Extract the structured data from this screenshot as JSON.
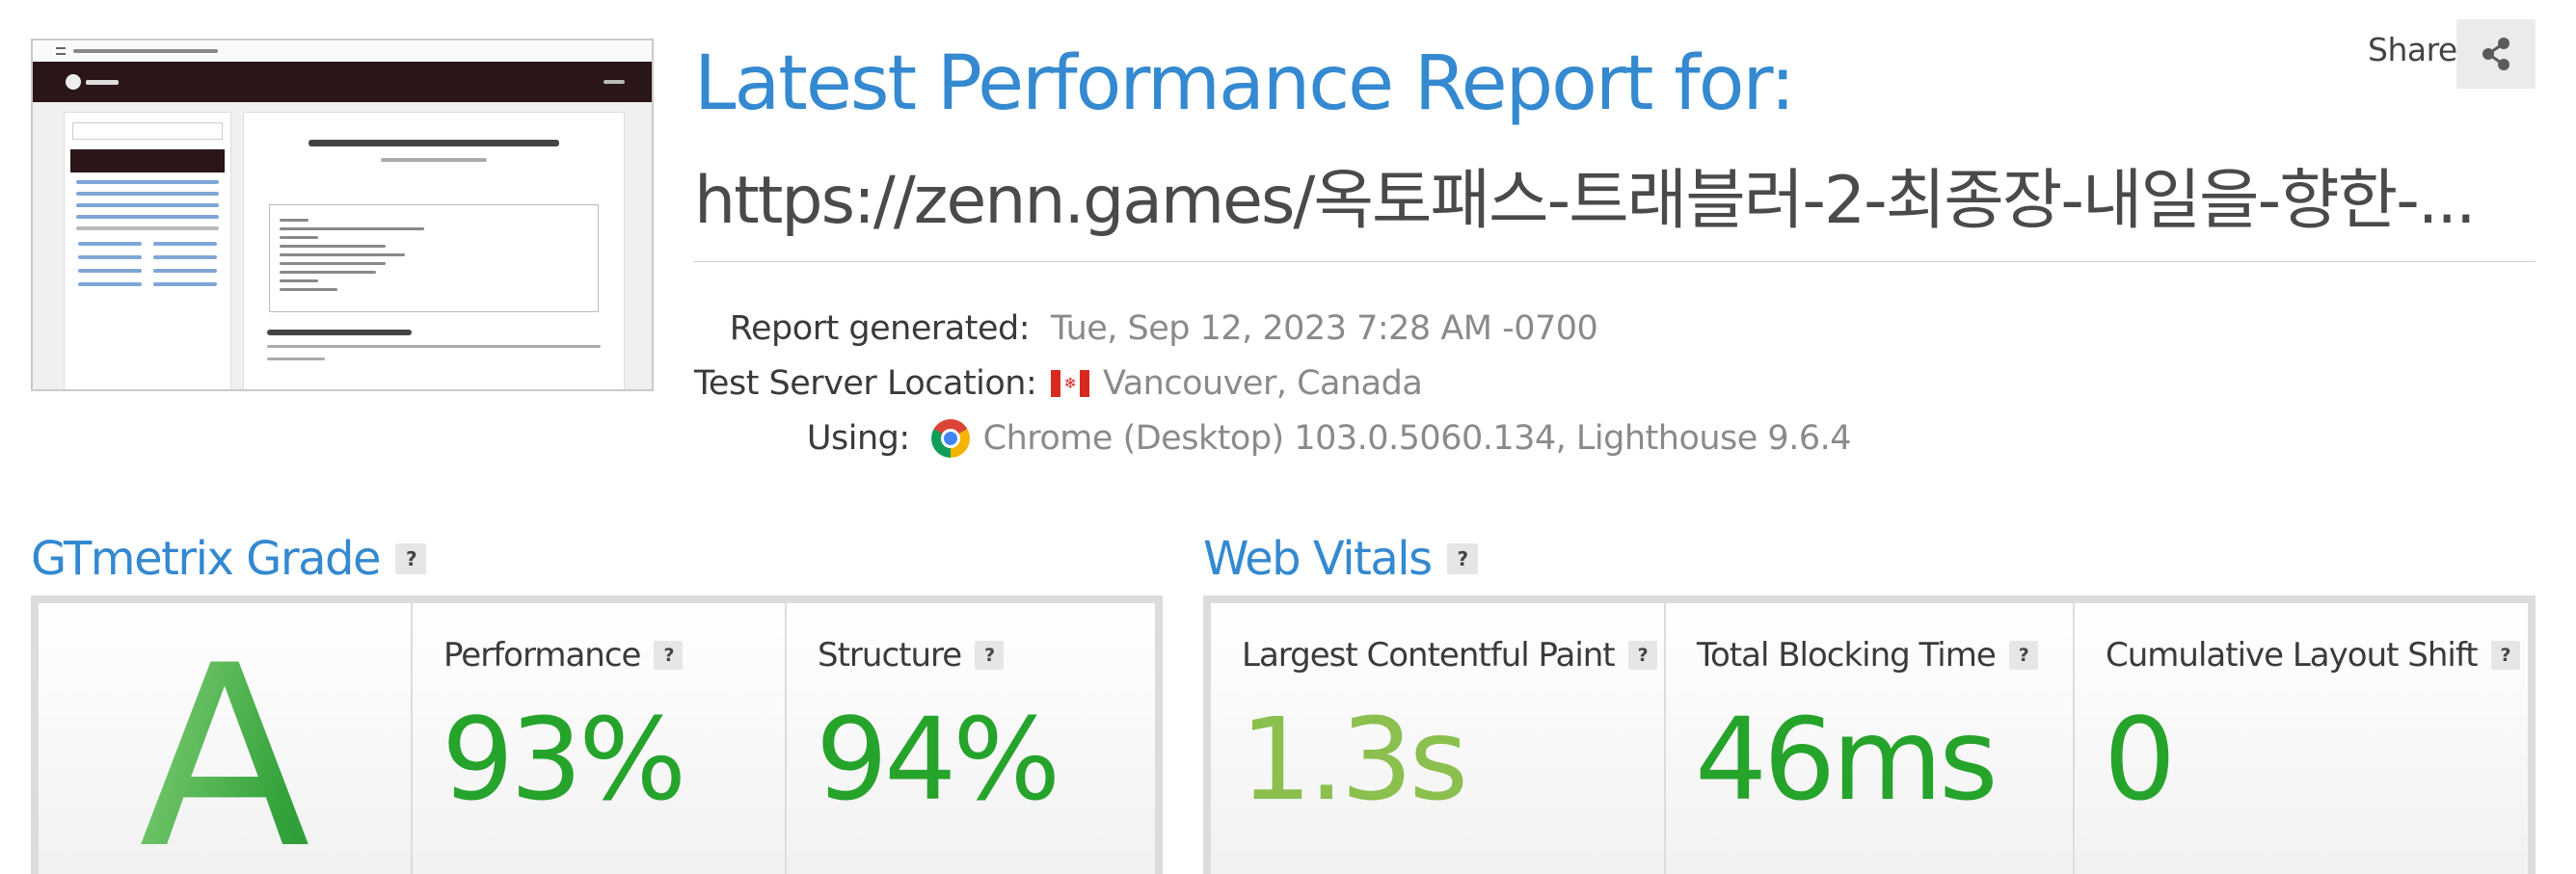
{
  "report": {
    "title": "Latest Performance Report for:",
    "url": "https://zenn.games/옥토패스-트래블러-2-최종장-내일을-향한-..."
  },
  "share": {
    "label": "Share"
  },
  "meta": [
    {
      "label": "Report generated:",
      "value": "Tue, Sep 12, 2023 7:28 AM -0700",
      "icon": "none"
    },
    {
      "label": "Test Server Location:",
      "value": "Vancouver, Canada",
      "icon": "canada-flag-icon"
    },
    {
      "label": "Using:",
      "value": "Chrome (Desktop) 103.0.5060.134, Lighthouse 9.6.4",
      "icon": "chrome-icon"
    }
  ],
  "help_glyph": "?",
  "grade": {
    "title": "GTmetrix Grade",
    "letter": "A",
    "performance": {
      "label": "Performance",
      "value": "93%"
    },
    "structure": {
      "label": "Structure",
      "value": "94%"
    }
  },
  "vitals": {
    "title": "Web Vitals",
    "lcp": {
      "label": "Largest Contentful Paint",
      "value": "1.3s"
    },
    "tbt": {
      "label": "Total Blocking Time",
      "value": "46ms"
    },
    "cls": {
      "label": "Cumulative Layout Shift",
      "value": "0"
    }
  },
  "colors": {
    "accent": "#3489d0",
    "good": "#26a32b",
    "ok": "#8bbf4e"
  }
}
